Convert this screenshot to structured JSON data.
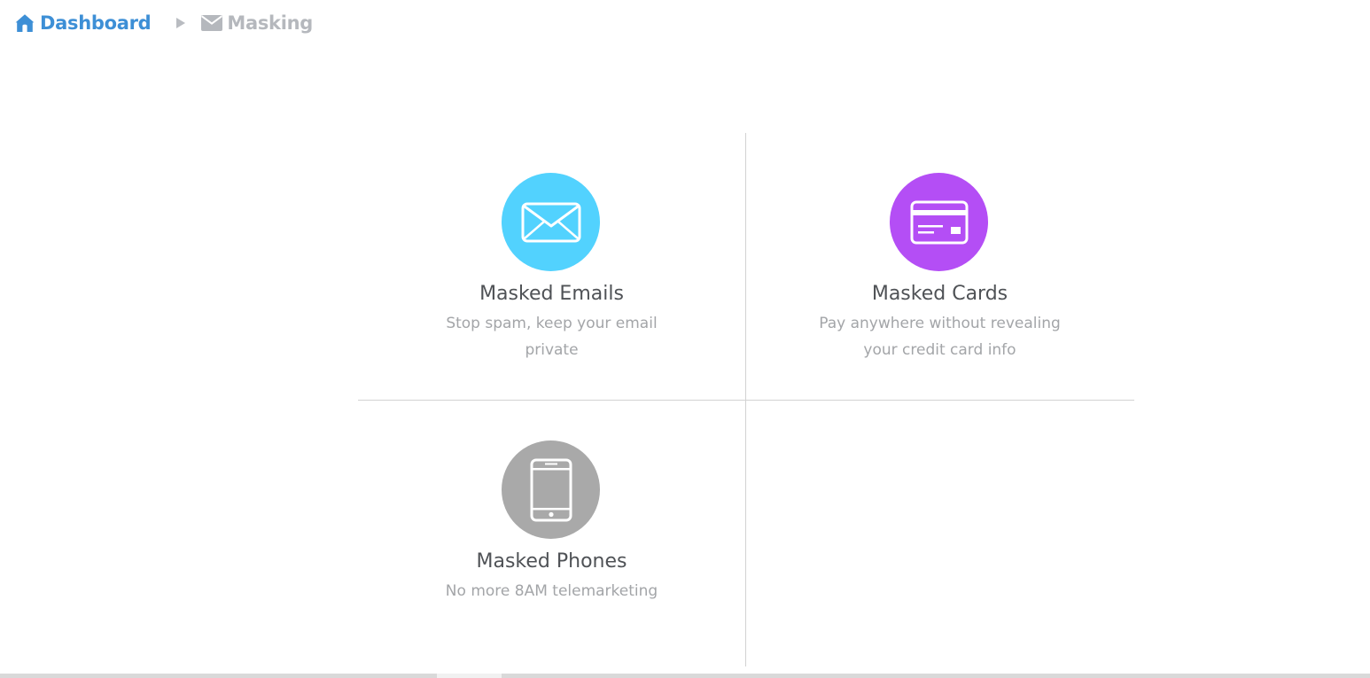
{
  "breadcrumb": {
    "home_label": "Dashboard",
    "home_icon": "home-icon",
    "separator_icon": "triangle-right-icon",
    "current_label": "Masking",
    "current_icon": "envelope-icon"
  },
  "cards": [
    {
      "title": "Masked Emails",
      "description": "Stop spam, keep your email private",
      "icon": "envelope-icon",
      "color": "#52d2fe"
    },
    {
      "title": "Masked Cards",
      "description": "Pay anywhere without revealing your credit card info",
      "icon": "credit-card-icon",
      "color": "#b44ef5"
    },
    {
      "title": "Masked Phones",
      "description": "No more 8AM telemarketing",
      "icon": "phone-icon",
      "color": "#a9a9a9"
    }
  ],
  "colors": {
    "link": "#3d8fd6",
    "breadcrumb_current": "#b5b8bd",
    "title_text": "#4f5256",
    "description_text": "#a3a5a8",
    "divider": "#d2d2d2"
  }
}
